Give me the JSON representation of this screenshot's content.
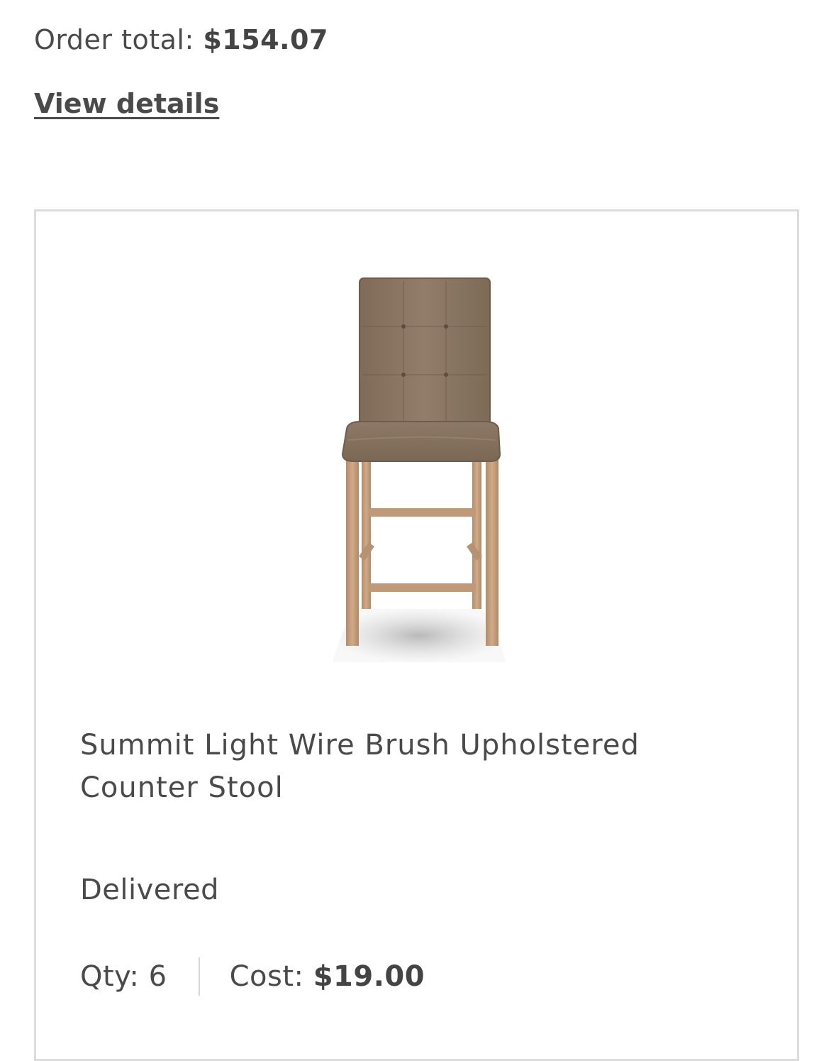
{
  "order": {
    "total_label": "Order total:",
    "total_value": "$154.07",
    "view_details_label": "View details"
  },
  "item": {
    "name": "Summit Light Wire Brush Upholstered Counter Stool",
    "image_icon": "counter-stool-image",
    "status": "Delivered",
    "qty_label": "Qty:",
    "qty_value": "6",
    "cost_label": "Cost:",
    "cost_value": "$19.00"
  },
  "colors": {
    "text": "#4a4a4a",
    "card_border": "#dcdcdc",
    "divider": "#d6d6d6",
    "upholstery": "#8b7865",
    "wood": "#c9a37e"
  }
}
